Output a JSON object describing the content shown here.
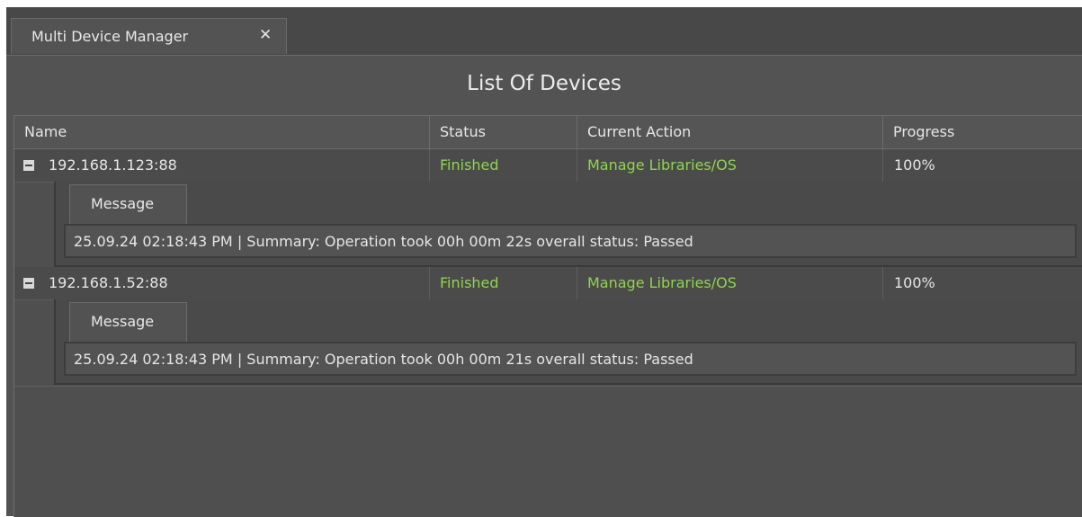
{
  "tab": {
    "title": "Multi Device Manager",
    "close_glyph": "✕",
    "close_icon": "close-icon"
  },
  "page": {
    "title": "List Of Devices"
  },
  "table": {
    "columns": [
      "Name",
      "Status",
      "Current Action",
      "Progress"
    ],
    "rows": [
      {
        "name": "192.168.1.123:88",
        "status": "Finished",
        "action": "Manage Libraries/OS",
        "progress": "100%",
        "expanded": true,
        "detail_tab": "Message",
        "message": "25.09.24 02:18:43 PM | Summary: Operation took 00h 00m 22s overall status: Passed"
      },
      {
        "name": "192.168.1.52:88",
        "status": "Finished",
        "action": "Manage Libraries/OS",
        "progress": "100%",
        "expanded": true,
        "detail_tab": "Message",
        "message": "25.09.24 02:18:43 PM | Summary: Operation took 00h 00m 21s overall status: Passed"
      }
    ]
  },
  "colors": {
    "background": "#535353",
    "status_accent": "#8ed64a",
    "text": "#e6e6e6"
  }
}
